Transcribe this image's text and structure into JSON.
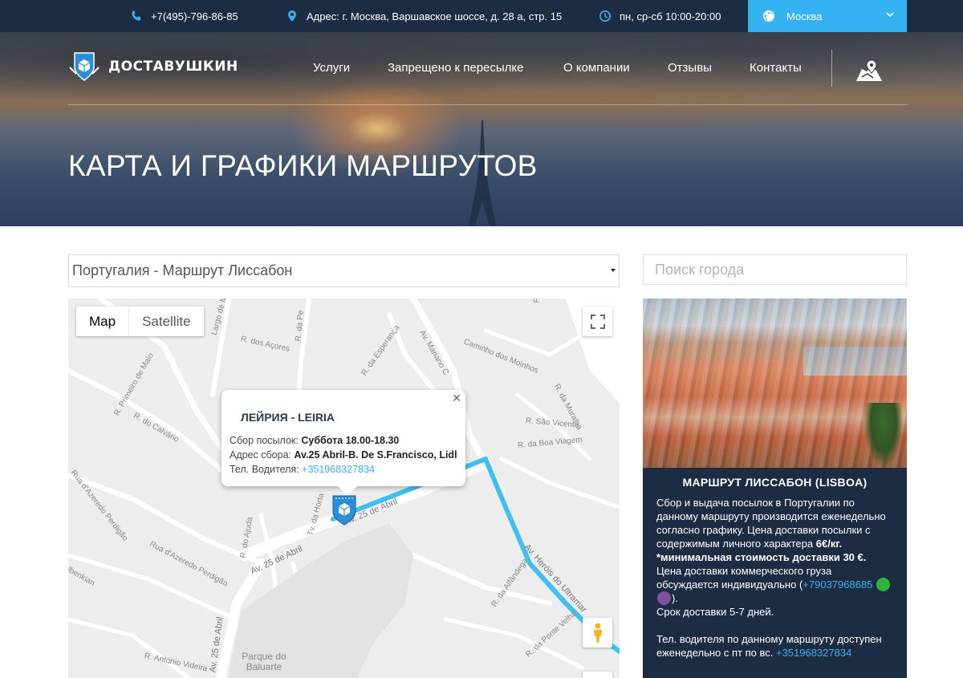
{
  "topbar": {
    "phone": "+7(495)-796-86-85",
    "address": "Адрес: г. Москва, Варшавское шоссе, д. 28 а, стр. 15",
    "hours": "пн, ср-сб 10:00-20:00",
    "city": "Москва"
  },
  "header": {
    "logo_text": "ДОСТАВУШКИН",
    "nav": [
      "Услуги",
      "Запрещено к пересылке",
      "О компании",
      "Отзывы",
      "Контакты"
    ],
    "page_title": "КАРТА И ГРАФИКИ МАРШРУТОВ"
  },
  "route_select": {
    "value": "Португалия - Маршрут Лиссабон"
  },
  "search": {
    "placeholder": "Поиск города"
  },
  "map": {
    "type_map": "Map",
    "type_satellite": "Satellite",
    "infowindow": {
      "title": "ЛЕЙРИЯ - LEIRIA",
      "pickup_label": "Сбор посылок:",
      "pickup_value": "Суббота 18.00-18.30",
      "address_label": "Адрес сбора:",
      "address_value": "Av.25 Abril-B. De S.Francisco, Lidl",
      "phone_label": "Тел. Водителя:",
      "phone_value": "+351968327834"
    },
    "streets": [
      "R. Primeiro de Maio",
      "R. do Calvário",
      "Rua d'Azeredo Perdigão",
      "Rua d'Azeredo Perdigão",
      "Largo de Ma",
      "R. dos Açores",
      "R. da Pe",
      "R. da Esperança",
      "Av. Mariano C",
      "Caminho dos Moinhos",
      "R. da Muralha",
      "R. São Vicente",
      "R. da Boa Viagem",
      "Tv. da Horta",
      "R. do Ajuda",
      "Av. 25 de Abril",
      "Av. 25 de Abril",
      "R. da Alfândega",
      "R. da Ponte Velha",
      "R. António Videira",
      "Parque do Baluarte",
      "Av. 25 de Abril",
      "Av. Heróis do Ultramar",
      "lbenkian",
      "Fo"
    ]
  },
  "sidebar": {
    "title": "МАРШРУТ ЛИССАБОН (LISBOA)",
    "p1_text": "Сбор и выдача посылок в Португалии по данному маршруту производится еженедельно согласно графику. Цена доставки посылки с содержимым личного характера ",
    "p1_price": "6€/кг.",
    "p2_min": "*минимальная стоимость доставки 30 €.",
    "p3_text": "Цена доставки коммерческого груза обсуждается индивидуально (",
    "p3_phone": "+79037968685",
    "p3_end": ").",
    "p4": "Срок доставки 5-7 дней.",
    "p5_text": "Тел. водителя по данному маршруту доступен еженедельно с пт по вс. ",
    "p5_phone": "+351968327834"
  },
  "colors": {
    "navy": "#1b2c43",
    "accent": "#35b2f2",
    "route": "#3ec0f4"
  }
}
